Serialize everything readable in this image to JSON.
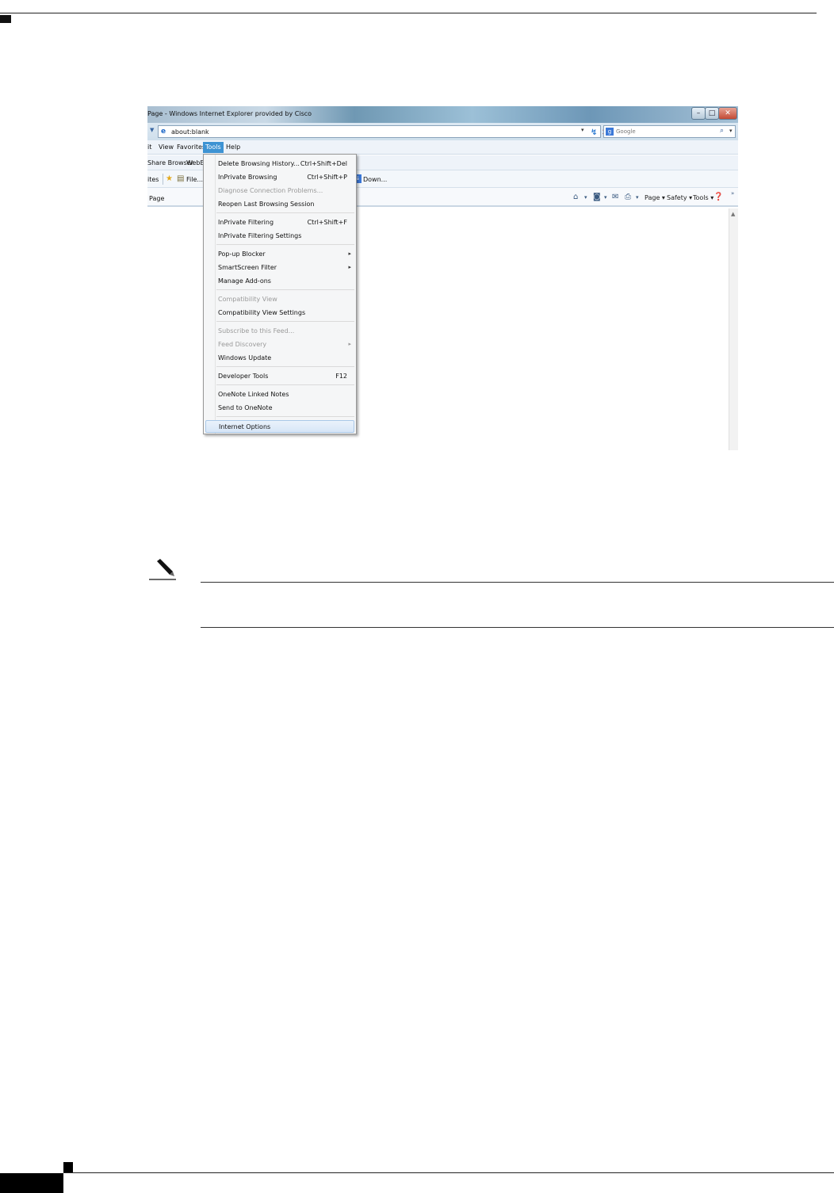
{
  "browser": {
    "title": "Page - Windows Internet Explorer provided by Cisco",
    "address": "about:blank",
    "search_placeholder": "Google"
  },
  "menubar": {
    "items": [
      "it",
      "View",
      "Favorites",
      "Tools",
      "Help"
    ],
    "active": "Tools"
  },
  "links_bar": {
    "items": [
      "Share Browser",
      "WebEx"
    ]
  },
  "favorites_bar": {
    "left_label": "ites",
    "file_label": "File...",
    "down_label": "Down..."
  },
  "command_bar": {
    "tab_label": "Page",
    "page": "Page ▾",
    "safety": "Safety ▾",
    "tools": "Tools ▾"
  },
  "tools_menu": {
    "items": [
      {
        "label": "Delete Browsing History...",
        "shortcut": "Ctrl+Shift+Del"
      },
      {
        "label": "InPrivate Browsing",
        "shortcut": "Ctrl+Shift+P"
      },
      {
        "label": "Diagnose Connection Problems...",
        "disabled": true
      },
      {
        "label": "Reopen Last Browsing Session"
      },
      {
        "label": "InPrivate Filtering",
        "shortcut": "Ctrl+Shift+F"
      },
      {
        "label": "InPrivate Filtering Settings"
      },
      {
        "label": "Pop-up Blocker",
        "submenu": true
      },
      {
        "label": "SmartScreen Filter",
        "submenu": true
      },
      {
        "label": "Manage Add-ons"
      },
      {
        "label": "Compatibility View",
        "disabled": true
      },
      {
        "label": "Compatibility View Settings"
      },
      {
        "label": "Subscribe to this Feed...",
        "disabled": true
      },
      {
        "label": "Feed Discovery",
        "disabled": true,
        "submenu": true
      },
      {
        "label": "Windows Update"
      },
      {
        "label": "Developer Tools",
        "shortcut": "F12"
      },
      {
        "label": "OneNote Linked Notes"
      },
      {
        "label": "Send to OneNote"
      },
      {
        "label": "Internet Options",
        "highlighted": true
      }
    ]
  },
  "icons": {
    "note": "pencil-note-icon"
  },
  "colors": {
    "menu_highlight": "#3e93d3",
    "titlebar": "#6f98b3"
  }
}
